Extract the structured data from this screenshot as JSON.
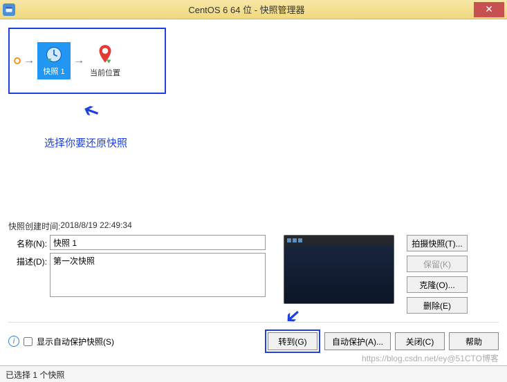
{
  "titlebar": {
    "title": "CentOS 6 64 位 - 快照管理器"
  },
  "tree": {
    "snapshot_label": "快照 1",
    "current_label": "当前位置"
  },
  "annotations": {
    "restore_hint": "选择你要还原快照"
  },
  "details": {
    "created_label": "快照创建时间:",
    "created_value": "2018/8/19 22:49:34",
    "name_label": "名称(N):",
    "name_value": "快照 1",
    "desc_label": "描述(D):",
    "desc_value": "第一次快照"
  },
  "side_buttons": {
    "take": "拍摄快照(T)...",
    "keep": "保留(K)",
    "clone": "克隆(O)...",
    "delete": "删除(E)"
  },
  "bottom": {
    "show_auto": "显示自动保护快照(S)",
    "goto": "转到(G)",
    "auto_protect": "自动保护(A)...",
    "close": "关闭(C)",
    "help": "帮助"
  },
  "status": {
    "text": "已选择 1 个快照"
  },
  "watermark": "https://blog.csdn.net/ey@51CTO博客"
}
